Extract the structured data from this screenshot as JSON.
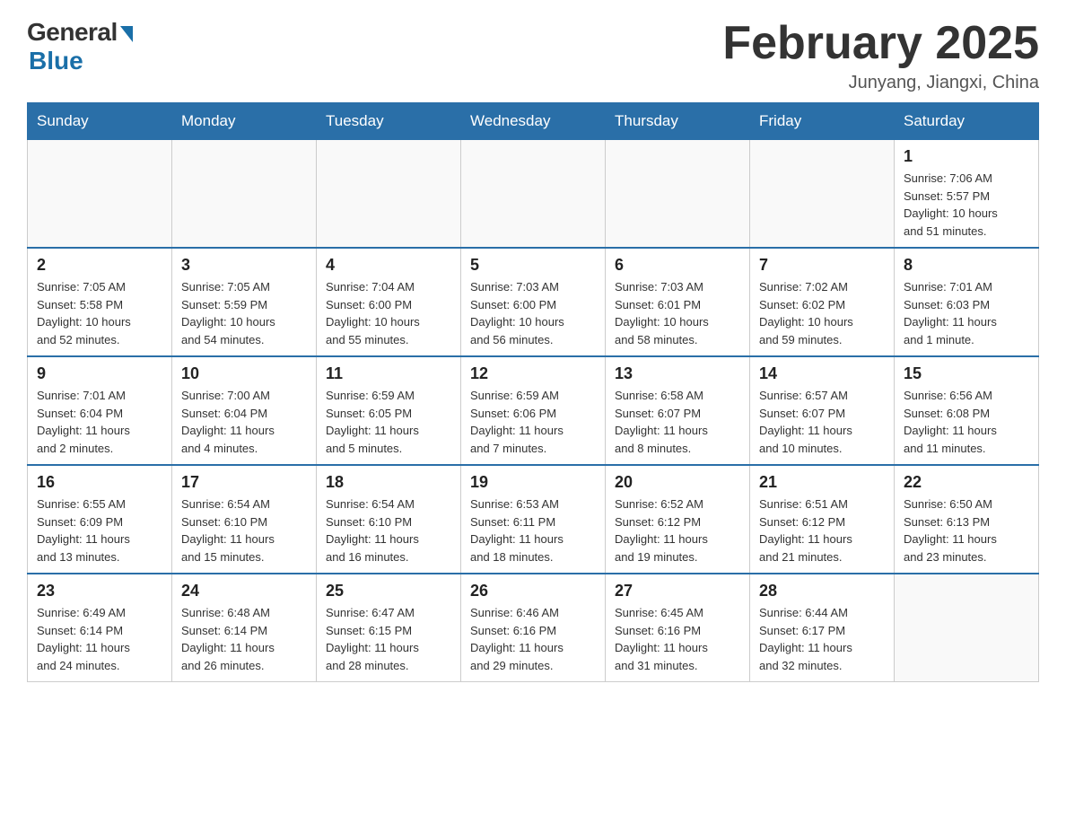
{
  "logo": {
    "general_text": "General",
    "blue_text": "Blue"
  },
  "title": "February 2025",
  "location": "Junyang, Jiangxi, China",
  "days_of_week": [
    "Sunday",
    "Monday",
    "Tuesday",
    "Wednesday",
    "Thursday",
    "Friday",
    "Saturday"
  ],
  "weeks": [
    [
      {
        "day": "",
        "info": ""
      },
      {
        "day": "",
        "info": ""
      },
      {
        "day": "",
        "info": ""
      },
      {
        "day": "",
        "info": ""
      },
      {
        "day": "",
        "info": ""
      },
      {
        "day": "",
        "info": ""
      },
      {
        "day": "1",
        "info": "Sunrise: 7:06 AM\nSunset: 5:57 PM\nDaylight: 10 hours\nand 51 minutes."
      }
    ],
    [
      {
        "day": "2",
        "info": "Sunrise: 7:05 AM\nSunset: 5:58 PM\nDaylight: 10 hours\nand 52 minutes."
      },
      {
        "day": "3",
        "info": "Sunrise: 7:05 AM\nSunset: 5:59 PM\nDaylight: 10 hours\nand 54 minutes."
      },
      {
        "day": "4",
        "info": "Sunrise: 7:04 AM\nSunset: 6:00 PM\nDaylight: 10 hours\nand 55 minutes."
      },
      {
        "day": "5",
        "info": "Sunrise: 7:03 AM\nSunset: 6:00 PM\nDaylight: 10 hours\nand 56 minutes."
      },
      {
        "day": "6",
        "info": "Sunrise: 7:03 AM\nSunset: 6:01 PM\nDaylight: 10 hours\nand 58 minutes."
      },
      {
        "day": "7",
        "info": "Sunrise: 7:02 AM\nSunset: 6:02 PM\nDaylight: 10 hours\nand 59 minutes."
      },
      {
        "day": "8",
        "info": "Sunrise: 7:01 AM\nSunset: 6:03 PM\nDaylight: 11 hours\nand 1 minute."
      }
    ],
    [
      {
        "day": "9",
        "info": "Sunrise: 7:01 AM\nSunset: 6:04 PM\nDaylight: 11 hours\nand 2 minutes."
      },
      {
        "day": "10",
        "info": "Sunrise: 7:00 AM\nSunset: 6:04 PM\nDaylight: 11 hours\nand 4 minutes."
      },
      {
        "day": "11",
        "info": "Sunrise: 6:59 AM\nSunset: 6:05 PM\nDaylight: 11 hours\nand 5 minutes."
      },
      {
        "day": "12",
        "info": "Sunrise: 6:59 AM\nSunset: 6:06 PM\nDaylight: 11 hours\nand 7 minutes."
      },
      {
        "day": "13",
        "info": "Sunrise: 6:58 AM\nSunset: 6:07 PM\nDaylight: 11 hours\nand 8 minutes."
      },
      {
        "day": "14",
        "info": "Sunrise: 6:57 AM\nSunset: 6:07 PM\nDaylight: 11 hours\nand 10 minutes."
      },
      {
        "day": "15",
        "info": "Sunrise: 6:56 AM\nSunset: 6:08 PM\nDaylight: 11 hours\nand 11 minutes."
      }
    ],
    [
      {
        "day": "16",
        "info": "Sunrise: 6:55 AM\nSunset: 6:09 PM\nDaylight: 11 hours\nand 13 minutes."
      },
      {
        "day": "17",
        "info": "Sunrise: 6:54 AM\nSunset: 6:10 PM\nDaylight: 11 hours\nand 15 minutes."
      },
      {
        "day": "18",
        "info": "Sunrise: 6:54 AM\nSunset: 6:10 PM\nDaylight: 11 hours\nand 16 minutes."
      },
      {
        "day": "19",
        "info": "Sunrise: 6:53 AM\nSunset: 6:11 PM\nDaylight: 11 hours\nand 18 minutes."
      },
      {
        "day": "20",
        "info": "Sunrise: 6:52 AM\nSunset: 6:12 PM\nDaylight: 11 hours\nand 19 minutes."
      },
      {
        "day": "21",
        "info": "Sunrise: 6:51 AM\nSunset: 6:12 PM\nDaylight: 11 hours\nand 21 minutes."
      },
      {
        "day": "22",
        "info": "Sunrise: 6:50 AM\nSunset: 6:13 PM\nDaylight: 11 hours\nand 23 minutes."
      }
    ],
    [
      {
        "day": "23",
        "info": "Sunrise: 6:49 AM\nSunset: 6:14 PM\nDaylight: 11 hours\nand 24 minutes."
      },
      {
        "day": "24",
        "info": "Sunrise: 6:48 AM\nSunset: 6:14 PM\nDaylight: 11 hours\nand 26 minutes."
      },
      {
        "day": "25",
        "info": "Sunrise: 6:47 AM\nSunset: 6:15 PM\nDaylight: 11 hours\nand 28 minutes."
      },
      {
        "day": "26",
        "info": "Sunrise: 6:46 AM\nSunset: 6:16 PM\nDaylight: 11 hours\nand 29 minutes."
      },
      {
        "day": "27",
        "info": "Sunrise: 6:45 AM\nSunset: 6:16 PM\nDaylight: 11 hours\nand 31 minutes."
      },
      {
        "day": "28",
        "info": "Sunrise: 6:44 AM\nSunset: 6:17 PM\nDaylight: 11 hours\nand 32 minutes."
      },
      {
        "day": "",
        "info": ""
      }
    ]
  ]
}
